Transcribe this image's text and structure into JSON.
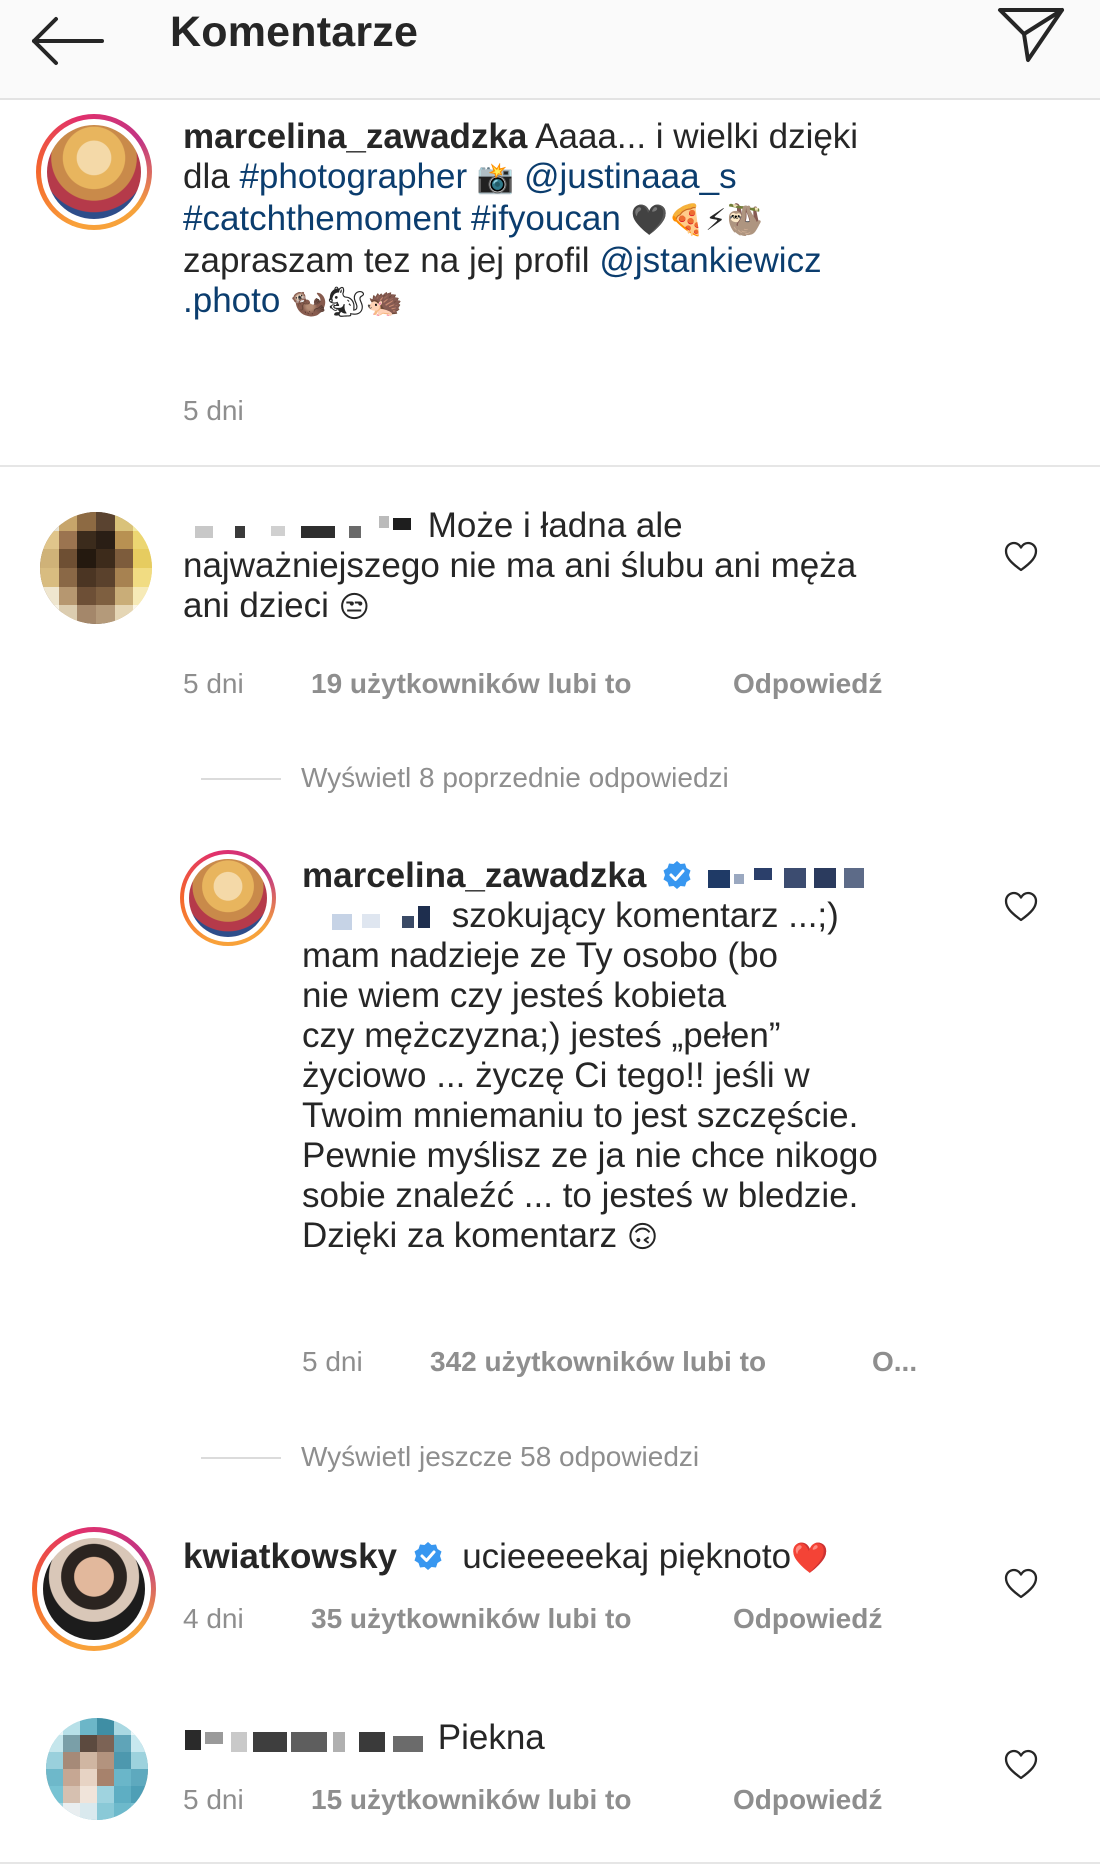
{
  "header": {
    "title": "Komentarze"
  },
  "caption": {
    "username": "marcelina_zawadzka",
    "text_1": "Aaaa... i wielki dzięki",
    "text_2": "dla",
    "tag_photographer": "#photographer",
    "mention_1": "@justinaaa_s",
    "tag_catch": "#catchthemoment",
    "tag_ifyoucan": "#ifyoucan",
    "text_3": "zapraszam tez na jej profil",
    "mention_2": "@jstankiewicz",
    "mention_2b": ".photo",
    "time": "5 dni",
    "emojis_line1": "📸",
    "emojis_line2": "🖤🍕⚡🦥",
    "emojis_line3": "🦦🐿🦔"
  },
  "comments": [
    {
      "text_1": "Może i ładna ale",
      "text_2": "najważniejszego nie ma ani ślubu ani męża",
      "text_3": "ani dzieci",
      "emoji": "😒",
      "time": "5 dni",
      "likes": "19 użytkowników lubi to",
      "reply": "Odpowiedź",
      "view_replies": "Wyświetl 8 poprzednie odpowiedzi"
    },
    {
      "username": "marcelina_zawadzka",
      "lines": [
        "szokujący komentarz ...;)",
        "mam nadzieje ze Ty osobo (bo",
        "nie wiem czy jesteś kobieta",
        "czy mężczyzna;) jesteś „pełen”",
        "życiowo ... życzę Ci tego!! jeśli w",
        "Twoim mniemaniu to jest szczęście.",
        "Pewnie myślisz ze ja nie chce nikogo",
        "sobie znaleźć ... to jesteś w bledzie.",
        "Dzięki za komentarz"
      ],
      "emoji": "🙃",
      "time": "5 dni",
      "likes": "342 użytkowników lubi to",
      "reply": "O...",
      "view_replies": "Wyświetl jeszcze 58 odpowiedzi"
    },
    {
      "username": "kwiatkowsky",
      "text": "ucieeeeekaj pięknoto",
      "emoji": "❤️",
      "time": "4 dni",
      "likes": "35 użytkowników lubi to",
      "reply": "Odpowiedź"
    },
    {
      "text": "Piekna",
      "time": "5 dni",
      "likes": "15 użytkowników lubi to",
      "reply": "Odpowiedź"
    }
  ],
  "colors": {
    "text": "#262626",
    "muted": "#8e8e8e",
    "link": "#0b3d6e",
    "verified": "#3897f0"
  }
}
